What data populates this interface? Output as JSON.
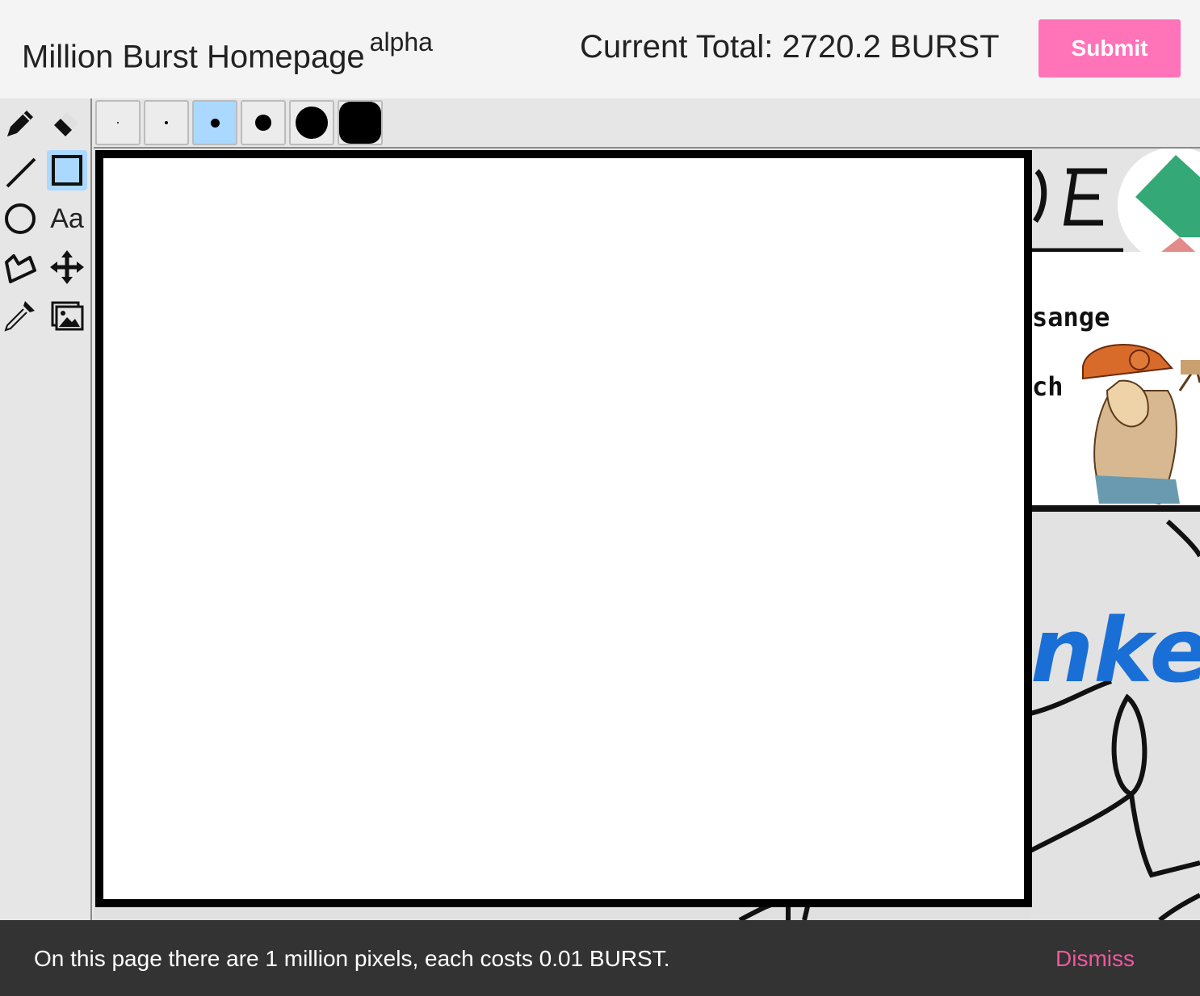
{
  "header": {
    "title": "Million Burst Homepage",
    "title_superscript": "alpha",
    "total": "Current Total: 2720.2 BURST",
    "submit_label": "Submit"
  },
  "toolbar": {
    "tools": [
      "pencil",
      "eraser",
      "line",
      "rectangle",
      "ellipse",
      "text",
      "polygon",
      "move",
      "eyedropper",
      "image"
    ],
    "active_tool": "rectangle",
    "text_tool_label": "Aa"
  },
  "brush_sizes": {
    "count": 6,
    "active_index": 2
  },
  "canvas": {
    "background_fragments": {
      "fragment_1": "sange",
      "fragment_2": "ch",
      "fragment_3": "nkey"
    }
  },
  "banner": {
    "message": "On this page there are 1 million pixels, each costs 0.01 BURST.",
    "dismiss_label": "Dismiss"
  },
  "colors": {
    "accent": "#ff73b8",
    "dismiss": "#f0579e",
    "active_tool_bg": "#aad8ff",
    "banner_bg": "#333333"
  }
}
